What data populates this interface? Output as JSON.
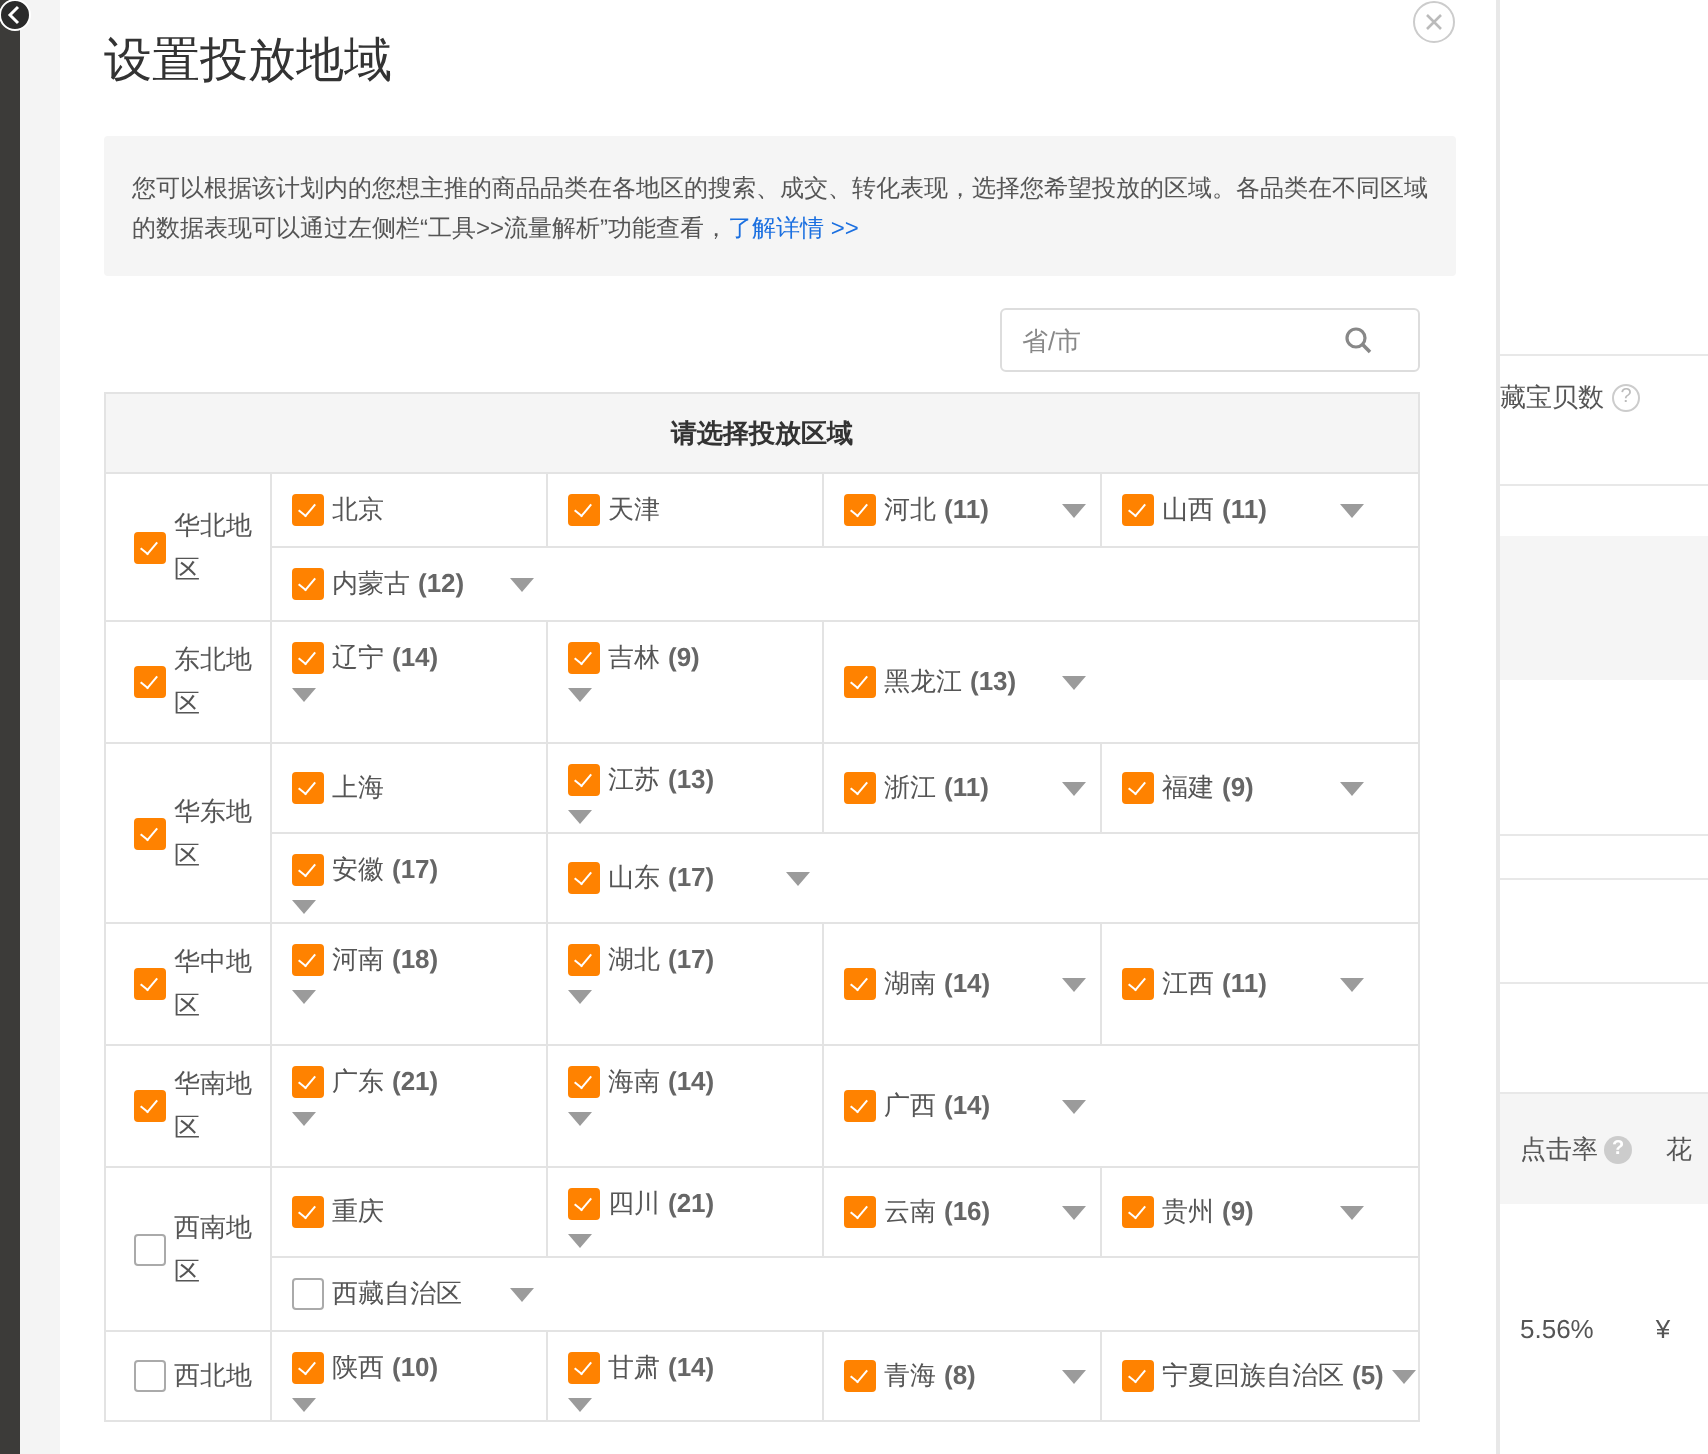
{
  "dialog": {
    "title": "设置投放地域",
    "info": {
      "text": "您可以根据该计划内的您想主推的商品品类在各地区的搜索、成交、转化表现，选择您希望投放的区域。各品类在不同区域的数据表现可以通过左侧栏“工具>>流量解析”功能查看，",
      "link": "了解详情 >>"
    },
    "search": {
      "placeholder": "省/市"
    },
    "table": {
      "heading": "请选择投放区域",
      "regions": [
        {
          "name": "华北地区",
          "checked": true,
          "provinces": [
            {
              "name": "北京",
              "checked": true,
              "expandable": false
            },
            {
              "name": "天津",
              "checked": true,
              "expandable": false
            },
            {
              "name": "河北",
              "count": "(11)",
              "checked": true,
              "expandable": true
            },
            {
              "name": "山西",
              "count": "(11)",
              "checked": true,
              "expandable": true
            },
            {
              "name": "内蒙古",
              "count": "(12)",
              "checked": true,
              "expandable": true
            }
          ]
        },
        {
          "name": "东北地区",
          "checked": true,
          "provinces": [
            {
              "name": "辽宁",
              "count": "(14)",
              "checked": true,
              "expandable": true
            },
            {
              "name": "吉林",
              "count": "(9)",
              "checked": true,
              "expandable": true
            },
            {
              "name": "黑龙江",
              "count": "(13)",
              "checked": true,
              "expandable": true
            }
          ]
        },
        {
          "name": "华东地区",
          "checked": true,
          "provinces": [
            {
              "name": "上海",
              "checked": true,
              "expandable": false
            },
            {
              "name": "江苏",
              "count": "(13)",
              "checked": true,
              "expandable": true
            },
            {
              "name": "浙江",
              "count": "(11)",
              "checked": true,
              "expandable": true
            },
            {
              "name": "福建",
              "count": "(9)",
              "checked": true,
              "expandable": true
            },
            {
              "name": "安徽",
              "count": "(17)",
              "checked": true,
              "expandable": true
            },
            {
              "name": "山东",
              "count": "(17)",
              "checked": true,
              "expandable": true
            }
          ]
        },
        {
          "name": "华中地区",
          "checked": true,
          "provinces": [
            {
              "name": "河南",
              "count": "(18)",
              "checked": true,
              "expandable": true
            },
            {
              "name": "湖北",
              "count": "(17)",
              "checked": true,
              "expandable": true
            },
            {
              "name": "湖南",
              "count": "(14)",
              "checked": true,
              "expandable": true
            },
            {
              "name": "江西",
              "count": "(11)",
              "checked": true,
              "expandable": true
            }
          ]
        },
        {
          "name": "华南地区",
          "checked": true,
          "provinces": [
            {
              "name": "广东",
              "count": "(21)",
              "checked": true,
              "expandable": true
            },
            {
              "name": "海南",
              "count": "(14)",
              "checked": true,
              "expandable": true
            },
            {
              "name": "广西",
              "count": "(14)",
              "checked": true,
              "expandable": true
            }
          ]
        },
        {
          "name": "西南地区",
          "checked": false,
          "provinces": [
            {
              "name": "重庆",
              "checked": true,
              "expandable": false
            },
            {
              "name": "四川",
              "count": "(21)",
              "checked": true,
              "expandable": true
            },
            {
              "name": "云南",
              "count": "(16)",
              "checked": true,
              "expandable": true
            },
            {
              "name": "贵州",
              "count": "(9)",
              "checked": true,
              "expandable": true
            },
            {
              "name": "西藏自治区",
              "checked": false,
              "expandable": true
            }
          ]
        },
        {
          "name": "西北地",
          "checked": false,
          "provinces": [
            {
              "name": "陕西",
              "count": "(10)",
              "checked": true,
              "expandable": true
            },
            {
              "name": "甘肃",
              "count": "(14)",
              "checked": true,
              "expandable": true
            },
            {
              "name": "青海",
              "count": "(8)",
              "checked": true,
              "expandable": true
            },
            {
              "name": "宁夏回族自治区",
              "count": "(5)",
              "checked": true,
              "expandable": true
            }
          ]
        }
      ]
    }
  },
  "background": {
    "column_1": "藏宝贝数",
    "column_1_help": "?",
    "column_2": "点击率",
    "column_2_help": "?",
    "column_3": "花",
    "cell_1": "5.56%",
    "cell_2": "¥"
  }
}
